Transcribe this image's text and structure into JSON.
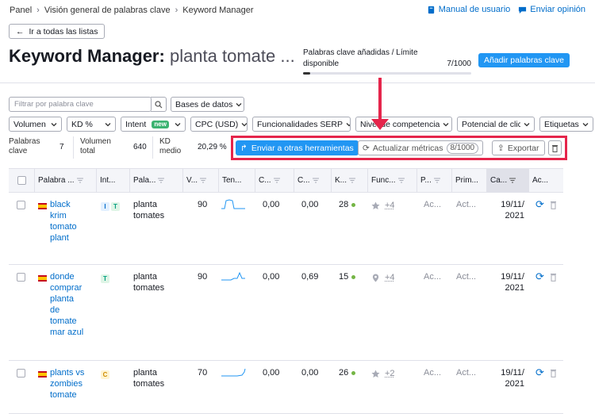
{
  "breadcrumb": [
    "Panel",
    "Visión general de palabras clave",
    "Keyword Manager"
  ],
  "toplinks": {
    "manual": "Manual de usuario",
    "feedback": "Enviar opinión"
  },
  "back_button": "Ir a todas las listas",
  "title": {
    "main": "Keyword Manager:",
    "list": "planta tomate ..."
  },
  "limit": {
    "label": "Palabras clave añadidas / Límite disponible",
    "value": "7/1000",
    "fraction": 0.007
  },
  "add_button": "Añadir palabras clave",
  "filters": {
    "search_placeholder": "Filtrar por palabra clave",
    "databases": "Bases de datos",
    "volume": "Volumen",
    "kd": "KD %",
    "intent": "Intent",
    "intent_badge": "new",
    "cpc": "CPC (USD)",
    "serp": "Funcionalidades SERP",
    "competition": "Nivel de competencia",
    "click_potential": "Potencial de clic",
    "tags": "Etiquetas"
  },
  "stats": {
    "keywords_label_1": "Palabras",
    "keywords_label_2": "clave",
    "keywords_value": "7",
    "volume_label_1": "Volumen",
    "volume_label_2": "total",
    "volume_value": "640",
    "kd_label_1": "KD",
    "kd_label_2": "medio",
    "kd_value": "20,29 %"
  },
  "actions": {
    "send": "Enviar a otras herramientas",
    "update": "Actualizar métricas",
    "update_count": "8/1000",
    "export": "Exportar"
  },
  "columns": {
    "keyword": "Palabra ...",
    "intent": "Int...",
    "list": "Pala...",
    "volume": "V...",
    "trend": "Ten...",
    "c1": "C...",
    "c2": "C...",
    "kd": "K...",
    "serp": "Func...",
    "p": "P...",
    "prim": "Prim...",
    "updated": "Ca...",
    "actions": "Ac..."
  },
  "rows": [
    {
      "keyword_lines": [
        "black",
        "krim",
        "tomato",
        "plant"
      ],
      "intents": [
        "I",
        "T"
      ],
      "list_lines": [
        "planta",
        "tomates"
      ],
      "volume": "90",
      "c1": "0,00",
      "c2": "0,00",
      "kd": "28",
      "serp_icon": "star-icon",
      "serp_more": "+4",
      "p": "Ac...",
      "prim": "Act...",
      "date_lines": [
        "19/11/",
        "2021"
      ]
    },
    {
      "keyword_lines": [
        "donde",
        "comprar",
        "planta",
        "de",
        "tomate",
        "mar azul"
      ],
      "intents": [
        "T"
      ],
      "list_lines": [
        "planta",
        "tomates"
      ],
      "volume": "90",
      "c1": "0,00",
      "c2": "0,69",
      "kd": "15",
      "serp_icon": "location-pin-icon",
      "serp_more": "+4",
      "p": "Ac...",
      "prim": "Act...",
      "date_lines": [
        "19/11/",
        "2021"
      ]
    },
    {
      "keyword_lines": [
        "plants vs",
        "zombies",
        "tomate"
      ],
      "intents": [
        "C"
      ],
      "list_lines": [
        "planta",
        "tomates"
      ],
      "volume": "70",
      "c1": "0,00",
      "c2": "0,00",
      "kd": "26",
      "serp_icon": "star-icon",
      "serp_more": "+2",
      "p": "Ac...",
      "prim": "Act...",
      "date_lines": [
        "19/11/",
        "2021"
      ]
    }
  ]
}
